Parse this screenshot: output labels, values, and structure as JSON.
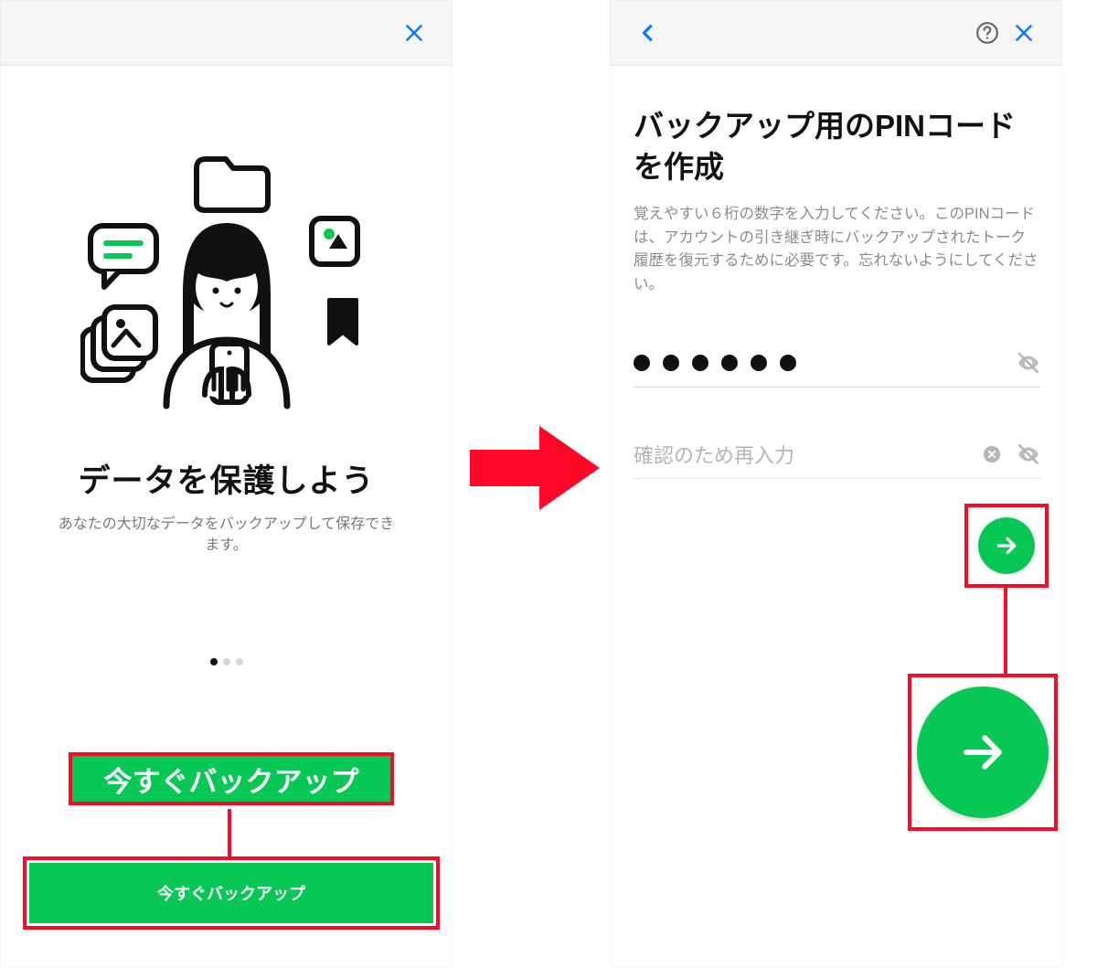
{
  "left": {
    "title": "データを保護しよう",
    "description": "あなたの大切なデータをバックアップして保存できます。",
    "callout_label": "今すぐバックアップ",
    "button_label": "今すぐバックアップ",
    "pager": {
      "count": 3,
      "active_index": 0
    }
  },
  "right": {
    "title": "バックアップ用のPINコードを作成",
    "description": "覚えやすい６桁の数字を入力してください。このPINコードは、アカウントの引き継ぎ時にバックアップされたトーク履歴を復元するために必要です。忘れないようにしてください。",
    "pin_filled_count": 6,
    "confirm_placeholder": "確認のため再入力"
  },
  "colors": {
    "accent_green": "#07c755",
    "highlight_red": "#ff0726",
    "ios_blue": "#0a7aff"
  }
}
